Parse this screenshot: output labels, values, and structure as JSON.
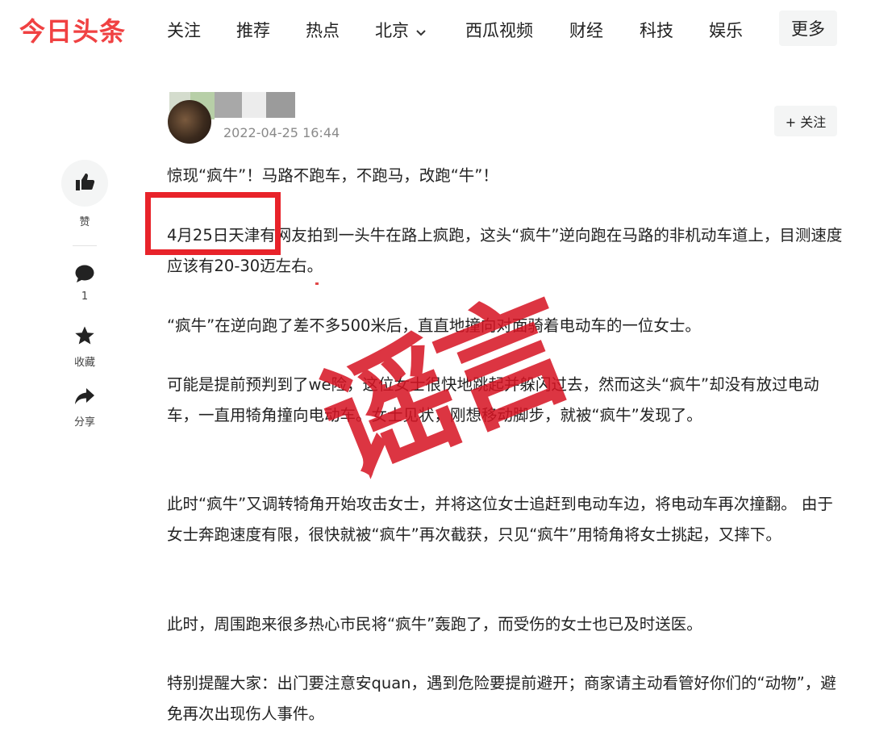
{
  "nav": {
    "logo": "今日头条",
    "items": [
      "关注",
      "推荐",
      "热点",
      "北京",
      "西瓜视频",
      "财经",
      "科技",
      "娱乐"
    ],
    "more": "更多"
  },
  "author": {
    "date": "2022-04-25 16:44",
    "follow_label": "+ 关注"
  },
  "rail": {
    "like_label": "赞",
    "comment_count": "1",
    "favorite_label": "收藏",
    "share_label": "分享"
  },
  "article": {
    "paragraphs": [
      "惊现“疯牛”！马路不跑车，不跑马，改跑“牛”！",
      "4月25日天津有网友拍到一头牛在路上疯跑，这头“疯牛”逆向跑在马路的非机动车道上，目测速度应该有20-30迈左右。",
      "“疯牛”在逆向跑了差不多500米后，直直地撞向对面骑着电动车的一位女士。",
      "可能是提前预判到了we险，这位女士很快地跳起并躲闪过去，然而这头“疯牛”却没有放过电动车，一直用犄角撞向电动车。女士见状，刚想移动脚步，就被“疯牛”发现了。",
      "此时“疯牛”又调转犄角开始攻击女士，并将这位女士追赶到电动车边，将电动车再次撞翻。 由于女士奔跑速度有限，很快就被“疯牛”再次截获，只见“疯牛”用犄角将女士挑起，又摔下。",
      "此时，周围跑来很多热心市民将“疯牛”轰跑了，而受伤的女士也已及时送医。",
      "特别提醒大家：出门要注意安quan，遇到危险要提前避开；商家请主动看管好你们的“动物”，避免再次出现伤人事件。"
    ]
  },
  "overlay": {
    "stamp_text": "谣言",
    "stamp_color": "#d61423",
    "box_color": "#e8232a"
  }
}
